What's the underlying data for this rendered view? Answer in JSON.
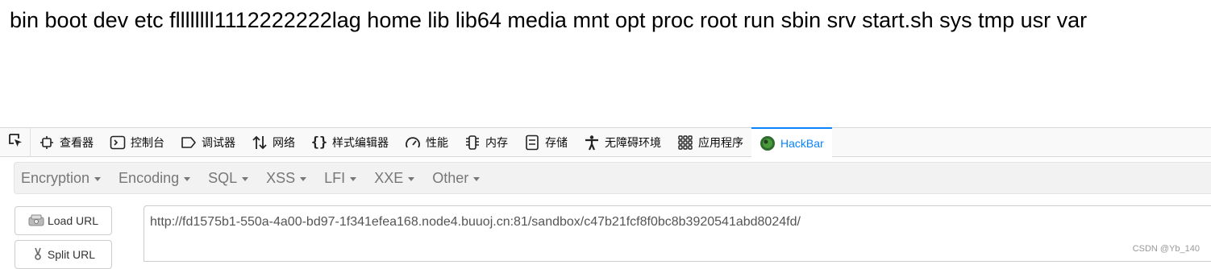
{
  "page": {
    "output_text": "bin boot dev etc fllllllll1112222222lag home lib lib64 media mnt opt proc root run sbin srv start.sh sys tmp usr var"
  },
  "devtools": {
    "tabs": [
      {
        "label": "查看器",
        "icon": "inspector-icon"
      },
      {
        "label": "控制台",
        "icon": "console-icon"
      },
      {
        "label": "调试器",
        "icon": "debugger-icon"
      },
      {
        "label": "网络",
        "icon": "network-icon"
      },
      {
        "label": "样式编辑器",
        "icon": "style-editor-icon"
      },
      {
        "label": "性能",
        "icon": "performance-icon"
      },
      {
        "label": "内存",
        "icon": "memory-icon"
      },
      {
        "label": "存储",
        "icon": "storage-icon"
      },
      {
        "label": "无障碍环境",
        "icon": "accessibility-icon"
      },
      {
        "label": "应用程序",
        "icon": "application-icon"
      },
      {
        "label": "HackBar",
        "icon": "hackbar-icon"
      }
    ],
    "active_tab": "HackBar",
    "accent_color": "#0a84ff"
  },
  "hackbar": {
    "menu": [
      "Encryption",
      "Encoding",
      "SQL",
      "XSS",
      "LFI",
      "XXE",
      "Other"
    ],
    "load_url_label": "Load URL",
    "split_url_label": "Split URL",
    "url_value": "http://fd1575b1-550a-4a00-bd97-1f341efea168.node4.buuoj.cn:81/sandbox/c47b21fcf8f0bc8b3920541abd8024fd/"
  },
  "watermark": "CSDN @Yb_140"
}
